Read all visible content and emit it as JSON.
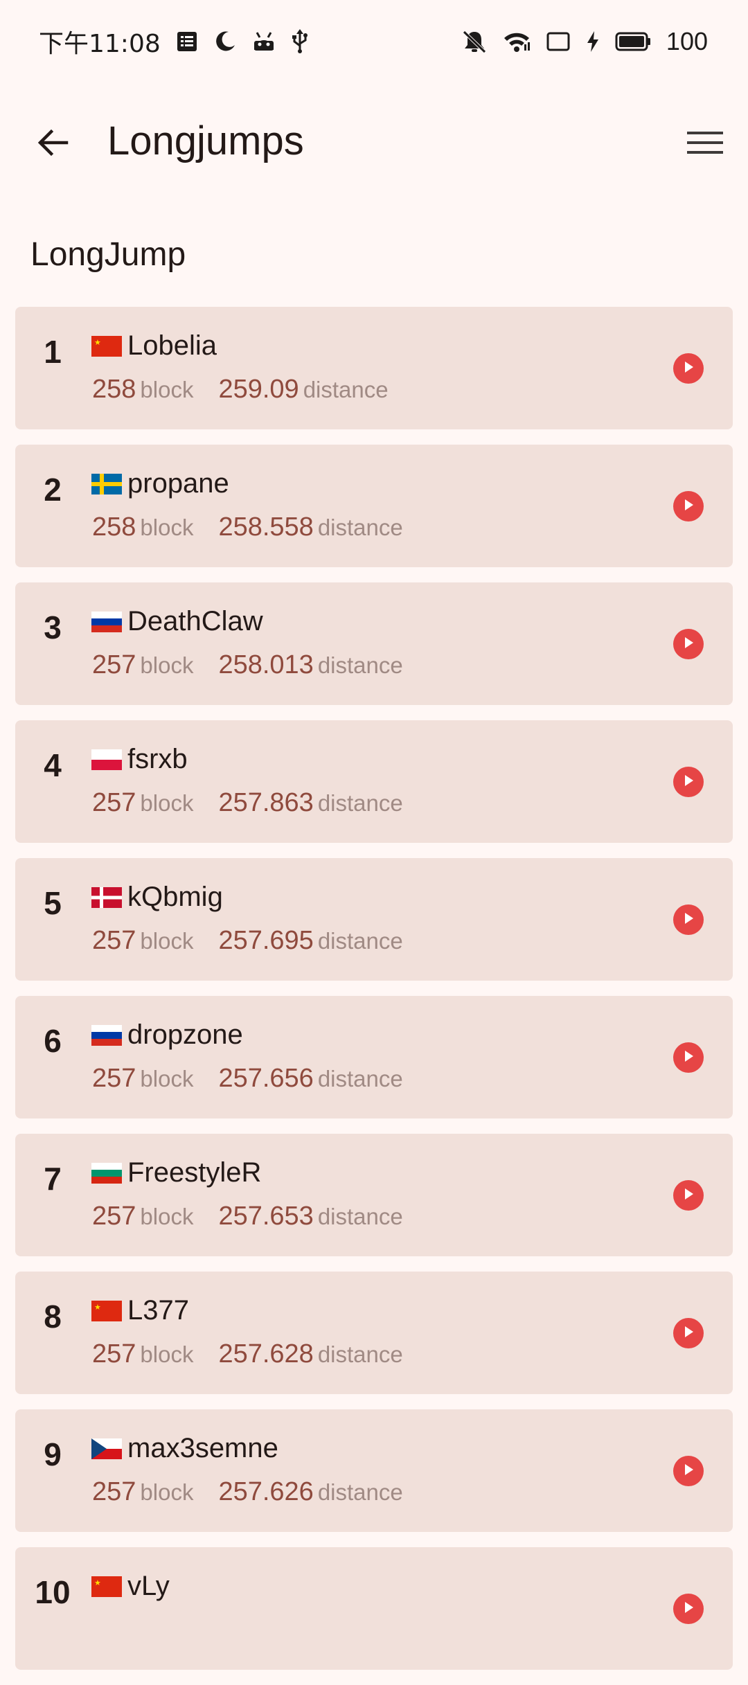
{
  "status_bar": {
    "time": "下午11:08",
    "battery": "100",
    "icons": [
      "notes-icon",
      "moon-icon",
      "android-icon",
      "usb-icon",
      "mute-icon",
      "wifi-icon",
      "cast-icon",
      "charging-icon",
      "battery-icon"
    ]
  },
  "app_bar": {
    "title": "Longjumps",
    "back_icon": "arrow-left-icon",
    "menu_icon": "menu-icon"
  },
  "section": {
    "title": "LongJump"
  },
  "labels": {
    "block": "block",
    "distance": "distance"
  },
  "colors": {
    "background": "#fff7f5",
    "card": "#f1e0da",
    "value": "#8f4a3d",
    "unit": "#a08a84",
    "play": "#e64545"
  },
  "rows": [
    {
      "rank": "1",
      "country": "CN",
      "name": "Lobelia",
      "block": "258",
      "distance": "259.09"
    },
    {
      "rank": "2",
      "country": "SE",
      "name": "propane",
      "block": "258",
      "distance": "258.558"
    },
    {
      "rank": "3",
      "country": "RU",
      "name": "DeathClaw",
      "block": "257",
      "distance": "258.013"
    },
    {
      "rank": "4",
      "country": "PL",
      "name": "fsrxb",
      "block": "257",
      "distance": "257.863"
    },
    {
      "rank": "5",
      "country": "DK",
      "name": "kQbmig",
      "block": "257",
      "distance": "257.695"
    },
    {
      "rank": "6",
      "country": "RU",
      "name": "dropzone",
      "block": "257",
      "distance": "257.656"
    },
    {
      "rank": "7",
      "country": "BG",
      "name": "FreestyleR",
      "block": "257",
      "distance": "257.653"
    },
    {
      "rank": "8",
      "country": "CN",
      "name": "L377",
      "block": "257",
      "distance": "257.628"
    },
    {
      "rank": "9",
      "country": "CZ",
      "name": "max3semne",
      "block": "257",
      "distance": "257.626"
    },
    {
      "rank": "10",
      "country": "CN",
      "name": "vLy",
      "block": "",
      "distance": ""
    }
  ]
}
